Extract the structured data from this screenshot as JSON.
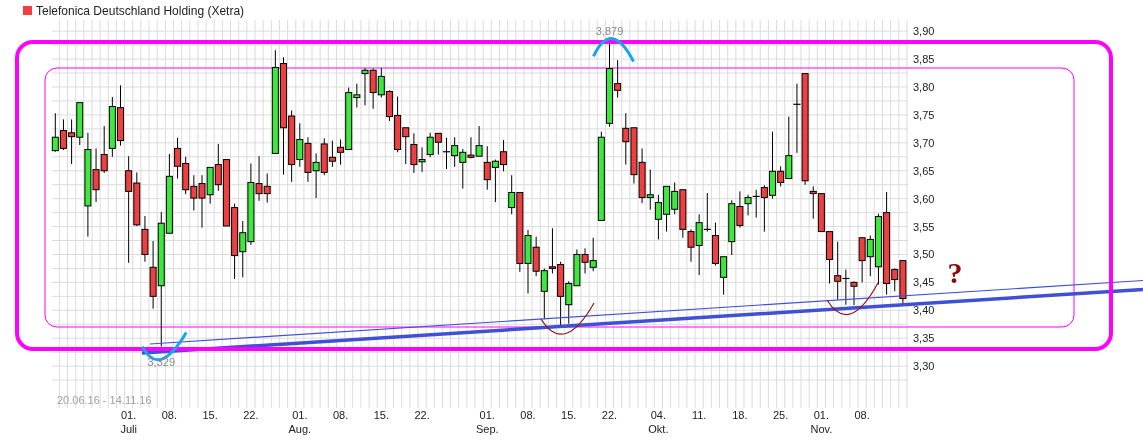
{
  "chart": {
    "legend": [
      {
        "label": "Telefonica Deutschland Holding (Xetra)",
        "color": "#ee4040"
      }
    ],
    "date_range": "20.06.16 - 14.11.16",
    "month_labels": [
      "Juli",
      "Aug.",
      "Sep.",
      "Okt.",
      "Nov."
    ],
    "chart_data": {
      "type": "candlestick",
      "ylim": [
        3.225,
        3.92
      ],
      "grid": true,
      "yticks": [
        {
          "value": 3.9,
          "label": "3,90"
        },
        {
          "value": 3.85,
          "label": "3,85"
        },
        {
          "value": 3.8,
          "label": "3,80"
        },
        {
          "value": 3.75,
          "label": "3,75"
        },
        {
          "value": 3.7,
          "label": "3,70"
        },
        {
          "value": 3.65,
          "label": "3,65"
        },
        {
          "value": 3.6,
          "label": "3,60"
        },
        {
          "value": 3.55,
          "label": "3,55"
        },
        {
          "value": 3.5,
          "label": "3,50"
        },
        {
          "value": 3.45,
          "label": "3,45"
        },
        {
          "value": 3.4,
          "label": "3,40"
        },
        {
          "value": 3.35,
          "label": "3,35"
        },
        {
          "value": 3.3,
          "label": "3,30"
        }
      ],
      "categories": [
        null,
        null,
        null,
        null,
        null,
        null,
        null,
        null,
        null,
        "01.",
        null,
        null,
        null,
        null,
        "08.",
        null,
        null,
        null,
        null,
        "15.",
        null,
        null,
        null,
        null,
        "22.",
        null,
        null,
        null,
        null,
        null,
        "01.",
        null,
        null,
        null,
        null,
        "08.",
        null,
        null,
        null,
        null,
        "15.",
        null,
        null,
        null,
        null,
        "22.",
        null,
        null,
        null,
        null,
        null,
        null,
        null,
        "01.",
        null,
        null,
        null,
        null,
        "08.",
        null,
        null,
        null,
        null,
        "15.",
        null,
        null,
        null,
        null,
        "22.",
        null,
        null,
        null,
        null,
        null,
        "04.",
        null,
        null,
        null,
        null,
        "11.",
        null,
        null,
        null,
        null,
        "18.",
        null,
        null,
        null,
        null,
        "25.",
        null,
        null,
        null,
        null,
        "01.",
        null,
        null,
        null,
        null,
        "08.",
        null,
        null,
        null,
        null,
        null
      ],
      "ohlc": [
        [
          3.686,
          3.753,
          3.684,
          3.71
        ],
        [
          3.722,
          3.742,
          3.687,
          3.69
        ],
        [
          3.718,
          3.742,
          3.662,
          3.711
        ],
        [
          3.71,
          3.772,
          3.696,
          3.772
        ],
        [
          3.587,
          3.718,
          3.532,
          3.688
        ],
        [
          3.652,
          3.69,
          3.594,
          3.616
        ],
        [
          3.679,
          3.73,
          3.646,
          3.65
        ],
        [
          3.69,
          3.782,
          3.675,
          3.765
        ],
        [
          3.763,
          3.803,
          3.695,
          3.704
        ],
        [
          3.65,
          3.676,
          3.485,
          3.613
        ],
        [
          3.628,
          3.647,
          3.551,
          3.553
        ],
        [
          3.545,
          3.569,
          3.487,
          3.5
        ],
        [
          3.477,
          3.524,
          3.403,
          3.425
        ],
        [
          3.444,
          3.576,
          3.335,
          3.556
        ],
        [
          3.538,
          3.68,
          3.538,
          3.64
        ],
        [
          3.69,
          3.709,
          3.636,
          3.658
        ],
        [
          3.663,
          3.675,
          3.608,
          3.616
        ],
        [
          3.622,
          3.642,
          3.579,
          3.601
        ],
        [
          3.627,
          3.642,
          3.548,
          3.601
        ],
        [
          3.607,
          3.656,
          3.591,
          3.656
        ],
        [
          3.661,
          3.698,
          3.614,
          3.625
        ],
        [
          3.67,
          3.67,
          3.551,
          3.551
        ],
        [
          3.584,
          3.591,
          3.456,
          3.498
        ],
        [
          3.505,
          3.56,
          3.459,
          3.539
        ],
        [
          3.523,
          3.663,
          3.517,
          3.629
        ],
        [
          3.627,
          3.676,
          3.596,
          3.609
        ],
        [
          3.622,
          3.645,
          3.593,
          3.609
        ],
        [
          3.681,
          3.866,
          3.681,
          3.835
        ],
        [
          3.842,
          3.853,
          3.643,
          3.727
        ],
        [
          3.748,
          3.758,
          3.63,
          3.661
        ],
        [
          3.67,
          3.735,
          3.657,
          3.706
        ],
        [
          3.699,
          3.71,
          3.63,
          3.647
        ],
        [
          3.65,
          3.681,
          3.601,
          3.665
        ],
        [
          3.698,
          3.708,
          3.642,
          3.647
        ],
        [
          3.674,
          3.704,
          3.657,
          3.667
        ],
        [
          3.692,
          3.706,
          3.661,
          3.683
        ],
        [
          3.688,
          3.799,
          3.688,
          3.79
        ],
        [
          3.781,
          3.806,
          3.763,
          3.786
        ],
        [
          3.824,
          3.834,
          3.767,
          3.83
        ],
        [
          3.83,
          3.833,
          3.761,
          3.79
        ],
        [
          3.786,
          3.834,
          3.781,
          3.819
        ],
        [
          3.792,
          3.794,
          3.739,
          3.747
        ],
        [
          3.749,
          3.783,
          3.683,
          3.688
        ],
        [
          3.727,
          3.727,
          3.662,
          3.711
        ],
        [
          3.697,
          3.717,
          3.646,
          3.661
        ],
        [
          3.666,
          3.692,
          3.648,
          3.67
        ],
        [
          3.679,
          3.718,
          3.674,
          3.71
        ],
        [
          3.717,
          3.717,
          3.679,
          3.701
        ],
        [
          3.684,
          3.709,
          3.653,
          3.684
        ],
        [
          3.677,
          3.71,
          3.657,
          3.695
        ],
        [
          3.665,
          3.689,
          3.618,
          3.683
        ],
        [
          3.678,
          3.71,
          3.672,
          3.674
        ],
        [
          3.676,
          3.73,
          3.676,
          3.695
        ],
        [
          3.665,
          3.694,
          3.616,
          3.634
        ],
        [
          3.656,
          3.67,
          3.594,
          3.667
        ],
        [
          3.684,
          3.705,
          3.649,
          3.661
        ],
        [
          3.584,
          3.642,
          3.572,
          3.611
        ],
        [
          3.611,
          3.611,
          3.469,
          3.484
        ],
        [
          3.484,
          3.544,
          3.43,
          3.534
        ],
        [
          3.513,
          3.532,
          3.461,
          3.47
        ],
        [
          3.434,
          3.475,
          3.384,
          3.471
        ],
        [
          3.478,
          3.547,
          3.466,
          3.475
        ],
        [
          3.482,
          3.487,
          3.373,
          3.425
        ],
        [
          3.41,
          3.452,
          3.376,
          3.448
        ],
        [
          3.444,
          3.509,
          3.444,
          3.5
        ],
        [
          3.5,
          3.511,
          3.466,
          3.486
        ],
        [
          3.477,
          3.53,
          3.47,
          3.489
        ],
        [
          3.561,
          3.72,
          3.561,
          3.71
        ],
        [
          3.735,
          3.878,
          3.729,
          3.833
        ],
        [
          3.806,
          3.848,
          3.781,
          3.794
        ],
        [
          3.726,
          3.753,
          3.661,
          3.702
        ],
        [
          3.727,
          3.727,
          3.627,
          3.643
        ],
        [
          3.665,
          3.69,
          3.592,
          3.602
        ],
        [
          3.602,
          3.652,
          3.58,
          3.607
        ],
        [
          3.563,
          3.607,
          3.527,
          3.593
        ],
        [
          3.572,
          3.622,
          3.541,
          3.622
        ],
        [
          3.581,
          3.629,
          3.572,
          3.613
        ],
        [
          3.616,
          3.616,
          3.53,
          3.545
        ],
        [
          3.541,
          3.545,
          3.487,
          3.513
        ],
        [
          3.516,
          3.572,
          3.463,
          3.557
        ],
        [
          3.545,
          3.61,
          3.541,
          3.545
        ],
        [
          3.534,
          3.557,
          3.48,
          3.484
        ],
        [
          3.459,
          3.496,
          3.428,
          3.496
        ],
        [
          3.523,
          3.597,
          3.499,
          3.591
        ],
        [
          3.586,
          3.613,
          3.548,
          3.552
        ],
        [
          3.591,
          3.607,
          3.57,
          3.602
        ],
        [
          3.604,
          3.616,
          3.566,
          3.604
        ],
        [
          3.62,
          3.624,
          3.541,
          3.602
        ],
        [
          3.606,
          3.72,
          3.6,
          3.649
        ],
        [
          3.649,
          3.658,
          3.622,
          3.629
        ],
        [
          3.636,
          3.747,
          3.636,
          3.677
        ],
        [
          3.769,
          3.806,
          3.682,
          3.769
        ],
        [
          3.824,
          3.824,
          3.625,
          3.632
        ],
        [
          3.613,
          3.622,
          3.564,
          3.609
        ],
        [
          3.609,
          3.609,
          3.541,
          3.541
        ],
        [
          3.541,
          3.541,
          3.448,
          3.491
        ],
        [
          3.462,
          3.523,
          3.419,
          3.452
        ],
        [
          3.457,
          3.473,
          3.41,
          3.457
        ],
        [
          3.45,
          3.452,
          3.409,
          3.443
        ],
        [
          3.53,
          3.53,
          3.45,
          3.489
        ],
        [
          3.496,
          3.534,
          3.461,
          3.527
        ],
        [
          3.478,
          3.573,
          3.446,
          3.568
        ],
        [
          3.575,
          3.612,
          3.428,
          3.448
        ],
        [
          3.473,
          3.475,
          3.434,
          3.455
        ],
        [
          3.489,
          3.489,
          3.41,
          3.421
        ]
      ],
      "annotations": [
        "3,329",
        "3,879",
        "?"
      ]
    }
  }
}
